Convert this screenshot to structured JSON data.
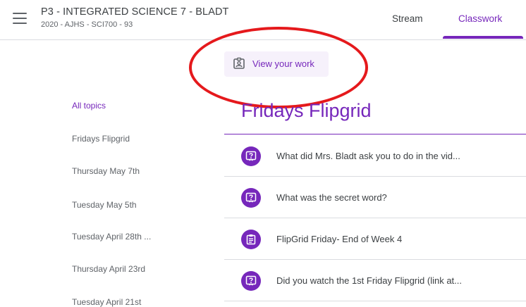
{
  "header": {
    "class_title": "P3 - INTEGRATED SCIENCE 7 - BLADT",
    "class_subtitle": "2020 - AJHS - SCI700 - 93",
    "tabs": [
      {
        "label": "Stream"
      },
      {
        "label": "Classwork",
        "active": true
      }
    ]
  },
  "view_work": {
    "label": "View your work",
    "icon": "assignment-ind-icon"
  },
  "topics": [
    {
      "label": "All topics",
      "active": true
    },
    {
      "label": "Fridays Flipgrid"
    },
    {
      "label": "Thursday May 7th"
    },
    {
      "label": "Tuesday May 5th"
    },
    {
      "label": "Tuesday April 28th ..."
    },
    {
      "label": "Thursday April 23rd"
    },
    {
      "label": "Tuesday April 21st"
    }
  ],
  "section": {
    "title": "Fridays Flipgrid",
    "items": [
      {
        "title": "What did Mrs. Bladt ask you to do in the vid...",
        "icon": "question-icon"
      },
      {
        "title": "What was the secret word?",
        "icon": "question-icon"
      },
      {
        "title": "FlipGrid Friday- End of Week 4",
        "icon": "assignment-icon"
      },
      {
        "title": "Did you watch the 1st Friday Flipgrid (link at...",
        "icon": "question-icon"
      }
    ]
  },
  "colors": {
    "accent": "#7627bb",
    "annotation_circle": "#e5191c",
    "text": "#3c4043",
    "muted": "#5f6368"
  }
}
